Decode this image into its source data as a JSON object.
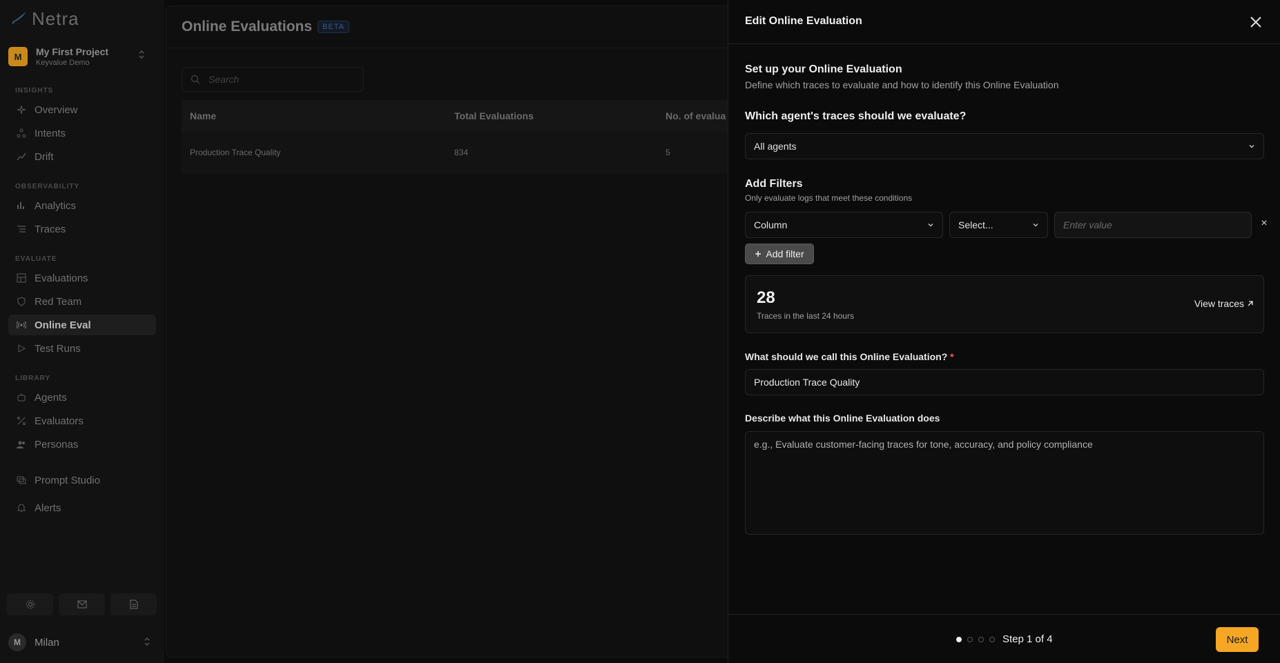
{
  "brand": {
    "name": "Netra"
  },
  "project": {
    "initial": "M",
    "name": "My First Project",
    "subtitle": "Keyvalue Demo"
  },
  "sidebar": {
    "sections": {
      "insights": "INSIGHTS",
      "observability": "OBSERVABILITY",
      "evaluate": "EVALUATE",
      "library": "LIBRARY"
    },
    "items": {
      "overview": "Overview",
      "intents": "Intents",
      "drift": "Drift",
      "analytics": "Analytics",
      "traces": "Traces",
      "evaluations": "Evaluations",
      "red_team": "Red Team",
      "online_eval": "Online Eval",
      "test_runs": "Test Runs",
      "agents": "Agents",
      "evaluators": "Evaluators",
      "personas": "Personas",
      "prompt_studio": "Prompt Studio",
      "alerts": "Alerts"
    },
    "active": "online_eval"
  },
  "user": {
    "initial": "M",
    "name": "Milan"
  },
  "main": {
    "title": "Online Evaluations",
    "badge": "BETA",
    "search_placeholder": "Search",
    "columns": [
      "Name",
      "Total Evaluations",
      "No. of evalua"
    ],
    "rows": [
      {
        "name": "Production Trace Quality",
        "total": "834",
        "count": "5"
      }
    ]
  },
  "drawer": {
    "title": "Edit Online Evaluation",
    "setup_heading": "Set up your Online Evaluation",
    "setup_desc": "Define which traces to evaluate and how to identify this Online Evaluation",
    "agent_question": "Which agent's traces should we evaluate?",
    "agent_selected": "All agents",
    "filters_heading": "Add Filters",
    "filters_desc": "Only evaluate logs that meet these conditions",
    "filter_column": "Column",
    "filter_operator": "Select...",
    "filter_value_placeholder": "Enter value",
    "filter_remove": "×",
    "add_filter_label": "Add filter",
    "stats_count": "28",
    "stats_label": "Traces in the last 24 hours",
    "view_traces": "View traces",
    "name_label": "What should we call this Online Evaluation?",
    "required_mark": "*",
    "name_value": "Production Trace Quality",
    "desc_label": "Describe what this Online Evaluation does",
    "desc_placeholder": "e.g., Evaluate customer-facing traces for tone, accuracy, and policy compliance",
    "step_text": "Step 1 of 4",
    "current_step": 1,
    "total_steps": 4,
    "next_label": "Next"
  },
  "colors": {
    "accent": "#f5a623",
    "project_avatar": "#c98a1a",
    "required": "#ff5555"
  }
}
